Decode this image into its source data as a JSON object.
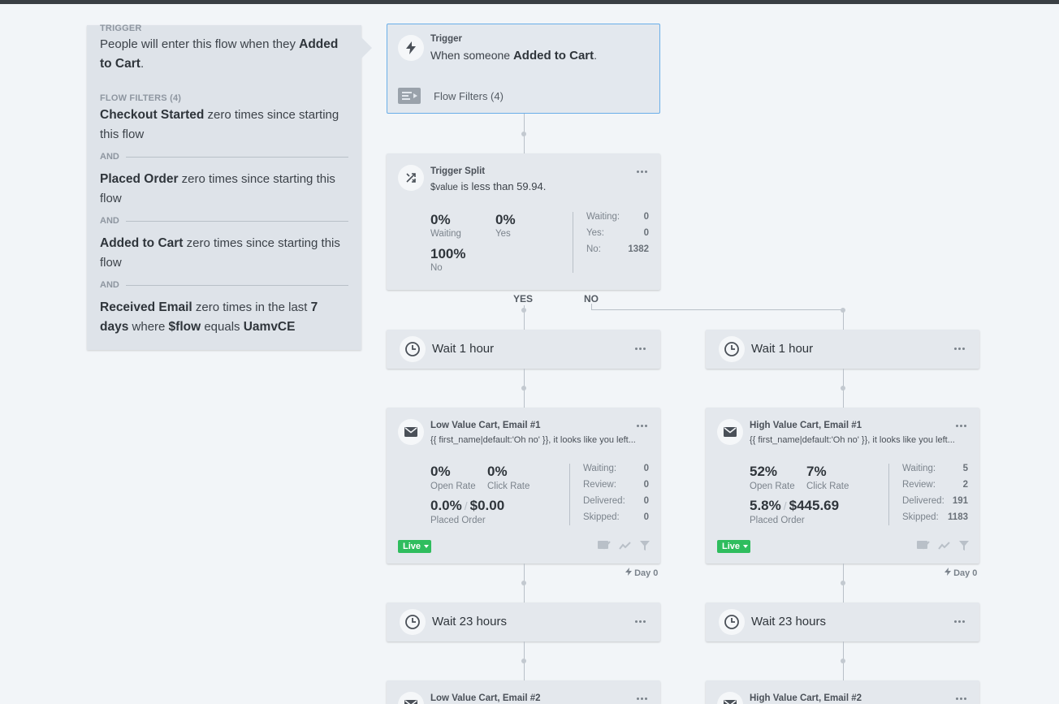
{
  "summary": {
    "trigger_heading": "TRIGGER",
    "trigger_text_prefix": "People will enter this flow when they",
    "trigger_event": "Added to Cart",
    "filters_heading": "FLOW FILTERS (4)",
    "and_label": "AND",
    "filters": [
      {
        "metric": "Checkout Started",
        "rest": "zero times since starting this flow"
      },
      {
        "metric": "Placed Order",
        "rest": "zero times since starting this flow"
      },
      {
        "metric": "Added to Cart",
        "rest": "zero times since starting this flow"
      },
      {
        "metric": "Received Email",
        "mid": "zero times in the last",
        "days": "7 days",
        "where": "where",
        "prop": "$flow",
        "equals": "equals",
        "value": "UamvCE"
      }
    ]
  },
  "trigger_node": {
    "title": "Trigger",
    "text_prefix": "When someone",
    "event": "Added to Cart",
    "filters_link": "Flow Filters (4)"
  },
  "split_node": {
    "title": "Trigger Split",
    "cond_var": "$value",
    "cond_text": "is less than 59.94.",
    "stats": [
      {
        "value": "0%",
        "label": "Waiting"
      },
      {
        "value": "0%",
        "label": "Yes"
      },
      {
        "value": "100%",
        "label": "No"
      }
    ],
    "counts": [
      {
        "key": "Waiting:",
        "value": "0"
      },
      {
        "key": "Yes:",
        "value": "0"
      },
      {
        "key": "No:",
        "value": "1382"
      }
    ],
    "yes_label": "YES",
    "no_label": "NO"
  },
  "left_branch": {
    "wait1": "Wait 1 hour",
    "email1": {
      "title": "Low Value Cart, Email #1",
      "snippet": "{{ first_name|default:'Oh no' }}, it looks like you left...",
      "open_rate": "0%",
      "open_label": "Open Rate",
      "click_rate": "0%",
      "click_label": "Click Rate",
      "conv_rate": "0.0%",
      "revenue": "$0.00",
      "conv_label": "Placed Order",
      "counts": [
        {
          "key": "Waiting:",
          "value": "0"
        },
        {
          "key": "Review:",
          "value": "0"
        },
        {
          "key": "Delivered:",
          "value": "0"
        },
        {
          "key": "Skipped:",
          "value": "0"
        }
      ],
      "status": "Live",
      "day": "Day 0"
    },
    "wait2": "Wait 23 hours",
    "email2_title": "Low Value Cart, Email #2"
  },
  "right_branch": {
    "wait1": "Wait 1 hour",
    "email1": {
      "title": "High Value Cart, Email #1",
      "snippet": "{{ first_name|default:'Oh no' }}, it looks like you left...",
      "open_rate": "52%",
      "open_label": "Open Rate",
      "click_rate": "7%",
      "click_label": "Click Rate",
      "conv_rate": "5.8%",
      "revenue": "$445.69",
      "conv_label": "Placed Order",
      "counts": [
        {
          "key": "Waiting:",
          "value": "5"
        },
        {
          "key": "Review:",
          "value": "2"
        },
        {
          "key": "Delivered:",
          "value": "191"
        },
        {
          "key": "Skipped:",
          "value": "1183"
        }
      ],
      "status": "Live",
      "day": "Day 0"
    },
    "wait2": "Wait 23 hours",
    "email2_title": "High Value Cart, Email #2"
  },
  "colors": {
    "accent_border": "#6aaee8",
    "live_green": "#2fbd5e",
    "panel_bg": "#dee3e9",
    "node_bg": "#e4e8ed"
  }
}
